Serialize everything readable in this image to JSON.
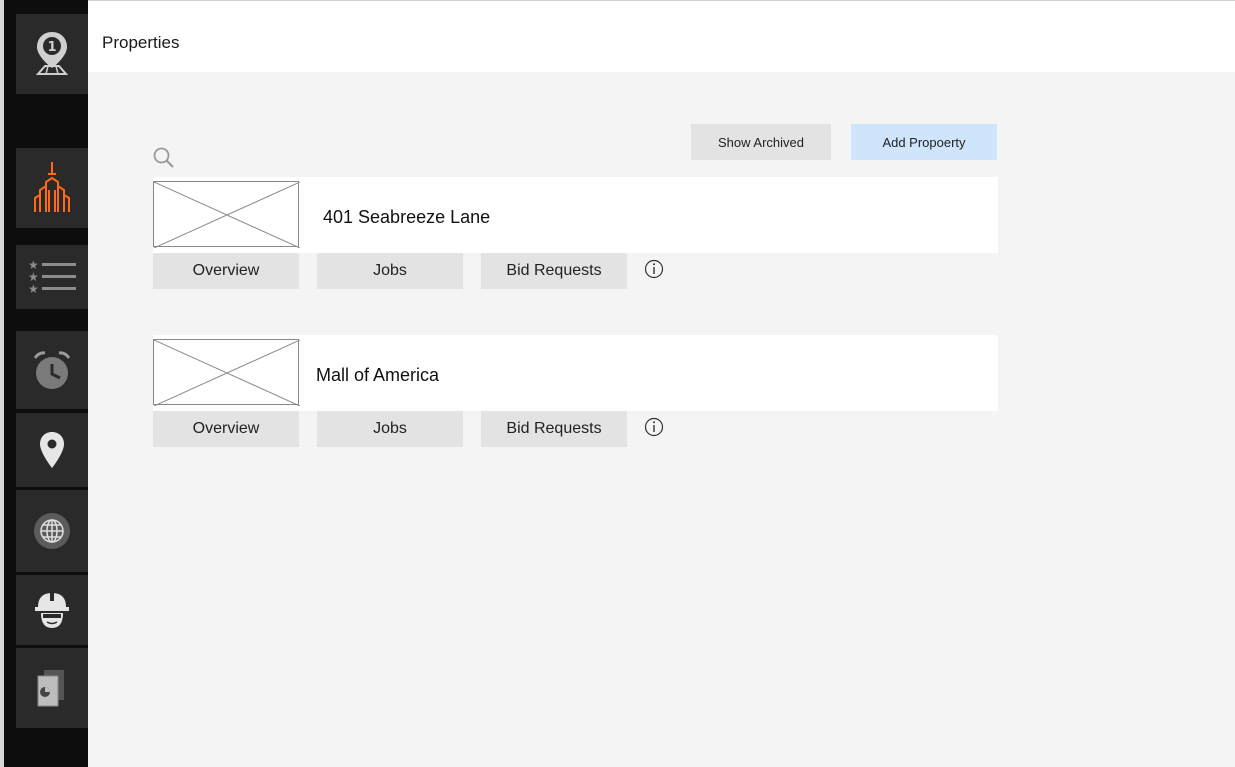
{
  "header": {
    "title": "Properties"
  },
  "sidebar": {
    "items": [
      {
        "name": "logo",
        "icon": "map-pin-number-icon",
        "badge": "1"
      },
      {
        "name": "properties",
        "icon": "building-icon",
        "active_color": "#ff6a1a"
      },
      {
        "name": "lists",
        "icon": "star-list-icon"
      },
      {
        "name": "alarms",
        "icon": "alarm-clock-icon"
      },
      {
        "name": "locations",
        "icon": "location-pin-icon"
      },
      {
        "name": "globe",
        "icon": "globe-icon"
      },
      {
        "name": "workers",
        "icon": "hard-hat-worker-icon"
      },
      {
        "name": "reports",
        "icon": "document-chart-icon"
      }
    ]
  },
  "toolbar": {
    "show_archived_label": "Show Archived",
    "add_property_label": "Add Propoerty"
  },
  "properties": [
    {
      "name": "401 Seabreeze Lane",
      "tabs": {
        "overview": "Overview",
        "jobs": "Jobs",
        "bids": "Bid Requests"
      }
    },
    {
      "name": "Mall of America",
      "tabs": {
        "overview": "Overview",
        "jobs": "Jobs",
        "bids": "Bid Requests"
      }
    }
  ],
  "colors": {
    "accent_active": "#ff6a1a",
    "primary_button": "#cfe5fb",
    "sidebar_bg": "#0d0d0d",
    "sidebar_tile": "#2a2a2a"
  }
}
